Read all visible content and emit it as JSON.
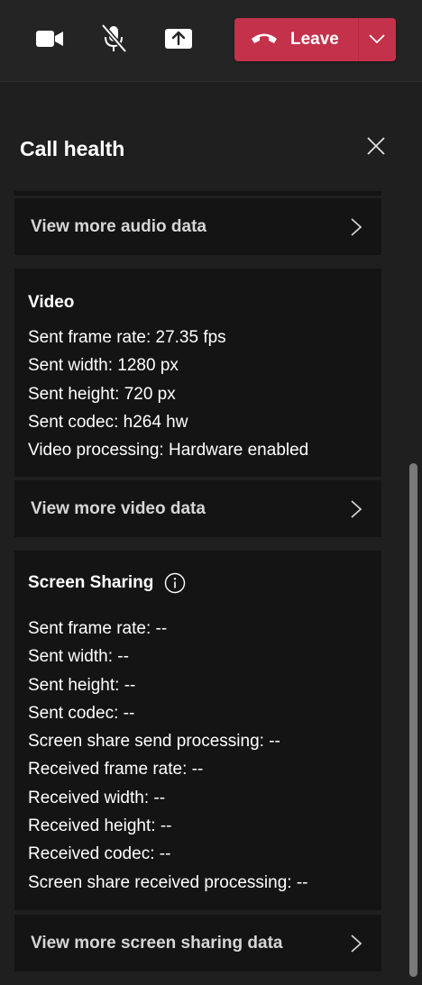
{
  "toolbar": {
    "camera_icon": "video-camera-icon",
    "mic_icon": "microphone-muted-icon",
    "share_icon": "share-screen-icon",
    "leave_label": "Leave",
    "leave_color": "#c4314b"
  },
  "panel": {
    "title": "Call health"
  },
  "audio": {
    "more_label": "View more audio data"
  },
  "video": {
    "title": "Video",
    "lines": [
      "Sent frame rate: 27.35 fps",
      "Sent width: 1280 px",
      "Sent height: 720 px",
      "Sent codec: h264 hw",
      "Video processing: Hardware enabled"
    ],
    "more_label": "View more video data"
  },
  "screen_sharing": {
    "title": "Screen Sharing",
    "lines": [
      "Sent frame rate: --",
      "Sent width: --",
      "Sent height: --",
      "Sent codec: --",
      "Screen share send processing: --",
      "Received frame rate: --",
      "Received width: --",
      "Received height: --",
      "Received codec: --",
      "Screen share received processing: --"
    ],
    "more_label": "View more screen sharing data"
  }
}
